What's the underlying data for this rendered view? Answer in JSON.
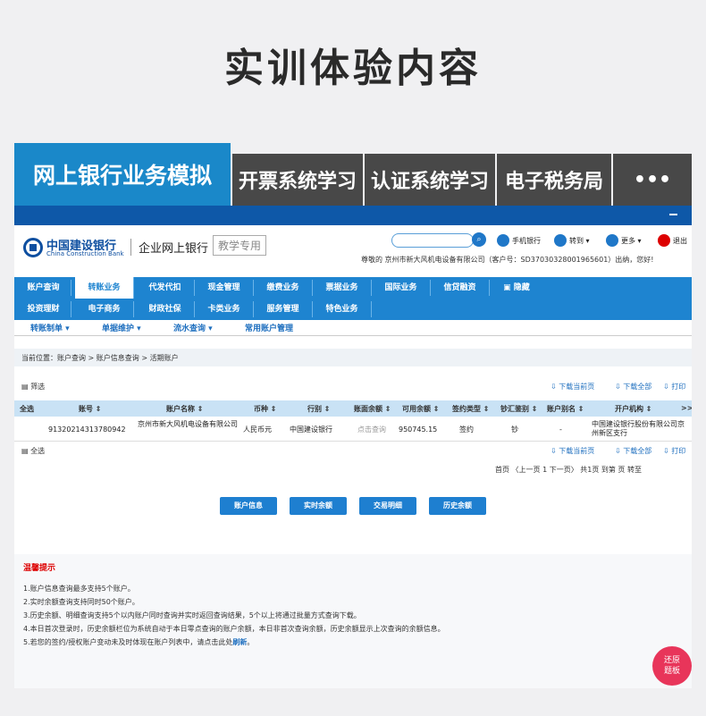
{
  "hero_title": "实训体验内容",
  "tabs": [
    "网上银行业务模拟",
    "开票系统学习",
    "认证系统学习",
    "电子税务局",
    "•••"
  ],
  "bank": {
    "logo_cn": "中国建设银行",
    "logo_en": "China Construction Bank",
    "corp_label": "企业网上银行",
    "teach_label": "教学专用",
    "tools": [
      "手机银行",
      "转到 ▾",
      "更多 ▾",
      "退出"
    ],
    "greeting": "尊敬的 京州市新大风机电设备有限公司（客户号：SD37030328001965601）出纳，您好!",
    "nav1": [
      "账户查询",
      "转账业务",
      "代发代扣",
      "现金管理",
      "缴费业务",
      "票据业务",
      "国际业务",
      "信贷融资",
      "▣ 隐藏"
    ],
    "nav2": [
      "投资理财",
      "电子商务",
      "财政社保",
      "卡类业务",
      "服务管理",
      "特色业务"
    ],
    "subnav": [
      "转账制单 ▾",
      "单据维护 ▾",
      "流水查询 ▾",
      "常用账户管理"
    ],
    "breadcrumb": "当前位置：账户查询 > 账户信息查询 > 活期账户",
    "filter": "▤ 筛选",
    "downloads": [
      "⇩ 下载当前页",
      "⇩ 下载全部",
      "⇩ 打印"
    ],
    "columns": [
      "全选",
      "账号 ⇕",
      "账户名称 ⇕",
      "币种 ⇕",
      "行别 ⇕",
      "账面余额 ⇕",
      "可用余额 ⇕",
      "签约类型 ⇕",
      "钞汇鉴别 ⇕",
      "账户别名 ⇕",
      "开户机构 ⇕",
      ">>"
    ],
    "row": {
      "account": "91320214313780942",
      "name": "京州市新大风机电设备有限公司",
      "currency": "人民币元",
      "bank": "中国建设银行",
      "book_balance": "点击查询",
      "available": "950745.15",
      "sign_type": "签约",
      "cash_type": "钞",
      "alias": "-",
      "branch": "中国建设银行股份有限公司京州新区支行"
    },
    "select_all": "▤ 全选",
    "pager": "首页 〈上一页 1 下一页〉 共1页 到第    页  转至",
    "buttons": [
      "账户信息",
      "实时余额",
      "交易明细",
      "历史余额"
    ],
    "tips_title": "温馨提示",
    "tips": [
      "1.账户信息查询最多支持5个账户。",
      "2.实时余额查询支持同时50个账户。",
      "3.历史余额、明细查询支持5个以内账户同时查询并实时返回查询结果，5个以上将通过批量方式查询下载。",
      "4.本日首次登录时，历史余额栏位为系统自动于本日零点查询的账户余额，本日非首次查询余额，历史余额显示上次查询的余额信息。",
      "5.若您的签约/授权账户变动未及时体现在账户列表中，请点击此处"
    ],
    "refresh_link": "刷新",
    "restore_label": "还原\n题板"
  }
}
